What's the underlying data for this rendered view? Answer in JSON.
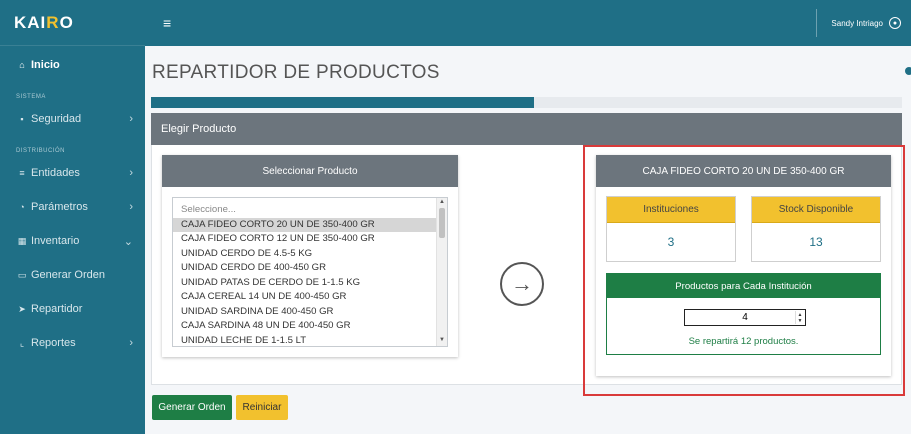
{
  "app": {
    "brand_part1": "KAI",
    "brand_accent": "R",
    "brand_part2": "O"
  },
  "topbar": {
    "menu_icon": "hamburger-icon",
    "user_name": "Sandy Intriago",
    "user_icon": "user-icon"
  },
  "sidebar": {
    "items": [
      {
        "label": "Inicio",
        "icon": "home-icon",
        "active": true
      },
      {
        "section": "SISTEMA"
      },
      {
        "label": "Seguridad",
        "icon": "lock-icon",
        "chevron": "chevron-right-icon"
      },
      {
        "section": "DISTRIBUCIÓN"
      },
      {
        "label": "Entidades",
        "icon": "list-icon",
        "chevron": "chevron-right-icon"
      },
      {
        "label": "Parámetros",
        "icon": "users-icon",
        "chevron": "chevron-right-icon"
      },
      {
        "label": "Inventario",
        "icon": "boxes-icon",
        "chevron": "chevron-down-icon"
      },
      {
        "label": "Generar Orden",
        "icon": "order-icon"
      },
      {
        "label": "Repartidor",
        "icon": "send-icon"
      },
      {
        "label": "Reportes",
        "icon": "chart-icon",
        "chevron": "chevron-right-icon"
      }
    ]
  },
  "main": {
    "page_title": "REPARTIDOR DE PRODUCTOS",
    "progress_fraction": 0.51,
    "card_title": "Elegir Producto",
    "select_card": {
      "title": "Seleccionar Producto",
      "options": [
        "Seleccione...",
        "CAJA FIDEO CORTO 20 UN DE 350-400 GR",
        "CAJA FIDEO CORTO 12 UN DE 350-400 GR",
        "UNIDAD CERDO DE 4.5-5 KG",
        "UNIDAD CERDO DE 400-450 GR",
        "UNIDAD PATAS DE CERDO DE 1-1.5 KG",
        "CAJA CEREAL 14 UN DE 400-450 GR",
        "UNIDAD SARDINA DE 400-450 GR",
        "CAJA SARDINA 48 UN DE 400-450 GR",
        "UNIDAD LECHE DE 1-1.5 LT"
      ],
      "selected_index": 1
    },
    "arrow_icon": "arrow-right-circle-icon",
    "product_card": {
      "title": "CAJA FIDEO CORTO 20 UN DE 350-400 GR",
      "instituciones_label": "Instituciones",
      "instituciones_value": "3",
      "stock_label": "Stock Disponible",
      "stock_value": "13",
      "dist_title": "Productos para Cada Institución",
      "dist_value": "4",
      "dist_note": "Se repartirá 12 productos."
    },
    "buttons": {
      "generate": "Generar Orden",
      "reset": "Reiniciar"
    }
  },
  "colors": {
    "primary": "#1f6f86",
    "accent": "#f2c12e",
    "success": "#1e7e45",
    "secondary": "#6c757d",
    "highlight_frame": "#d93a3a"
  }
}
